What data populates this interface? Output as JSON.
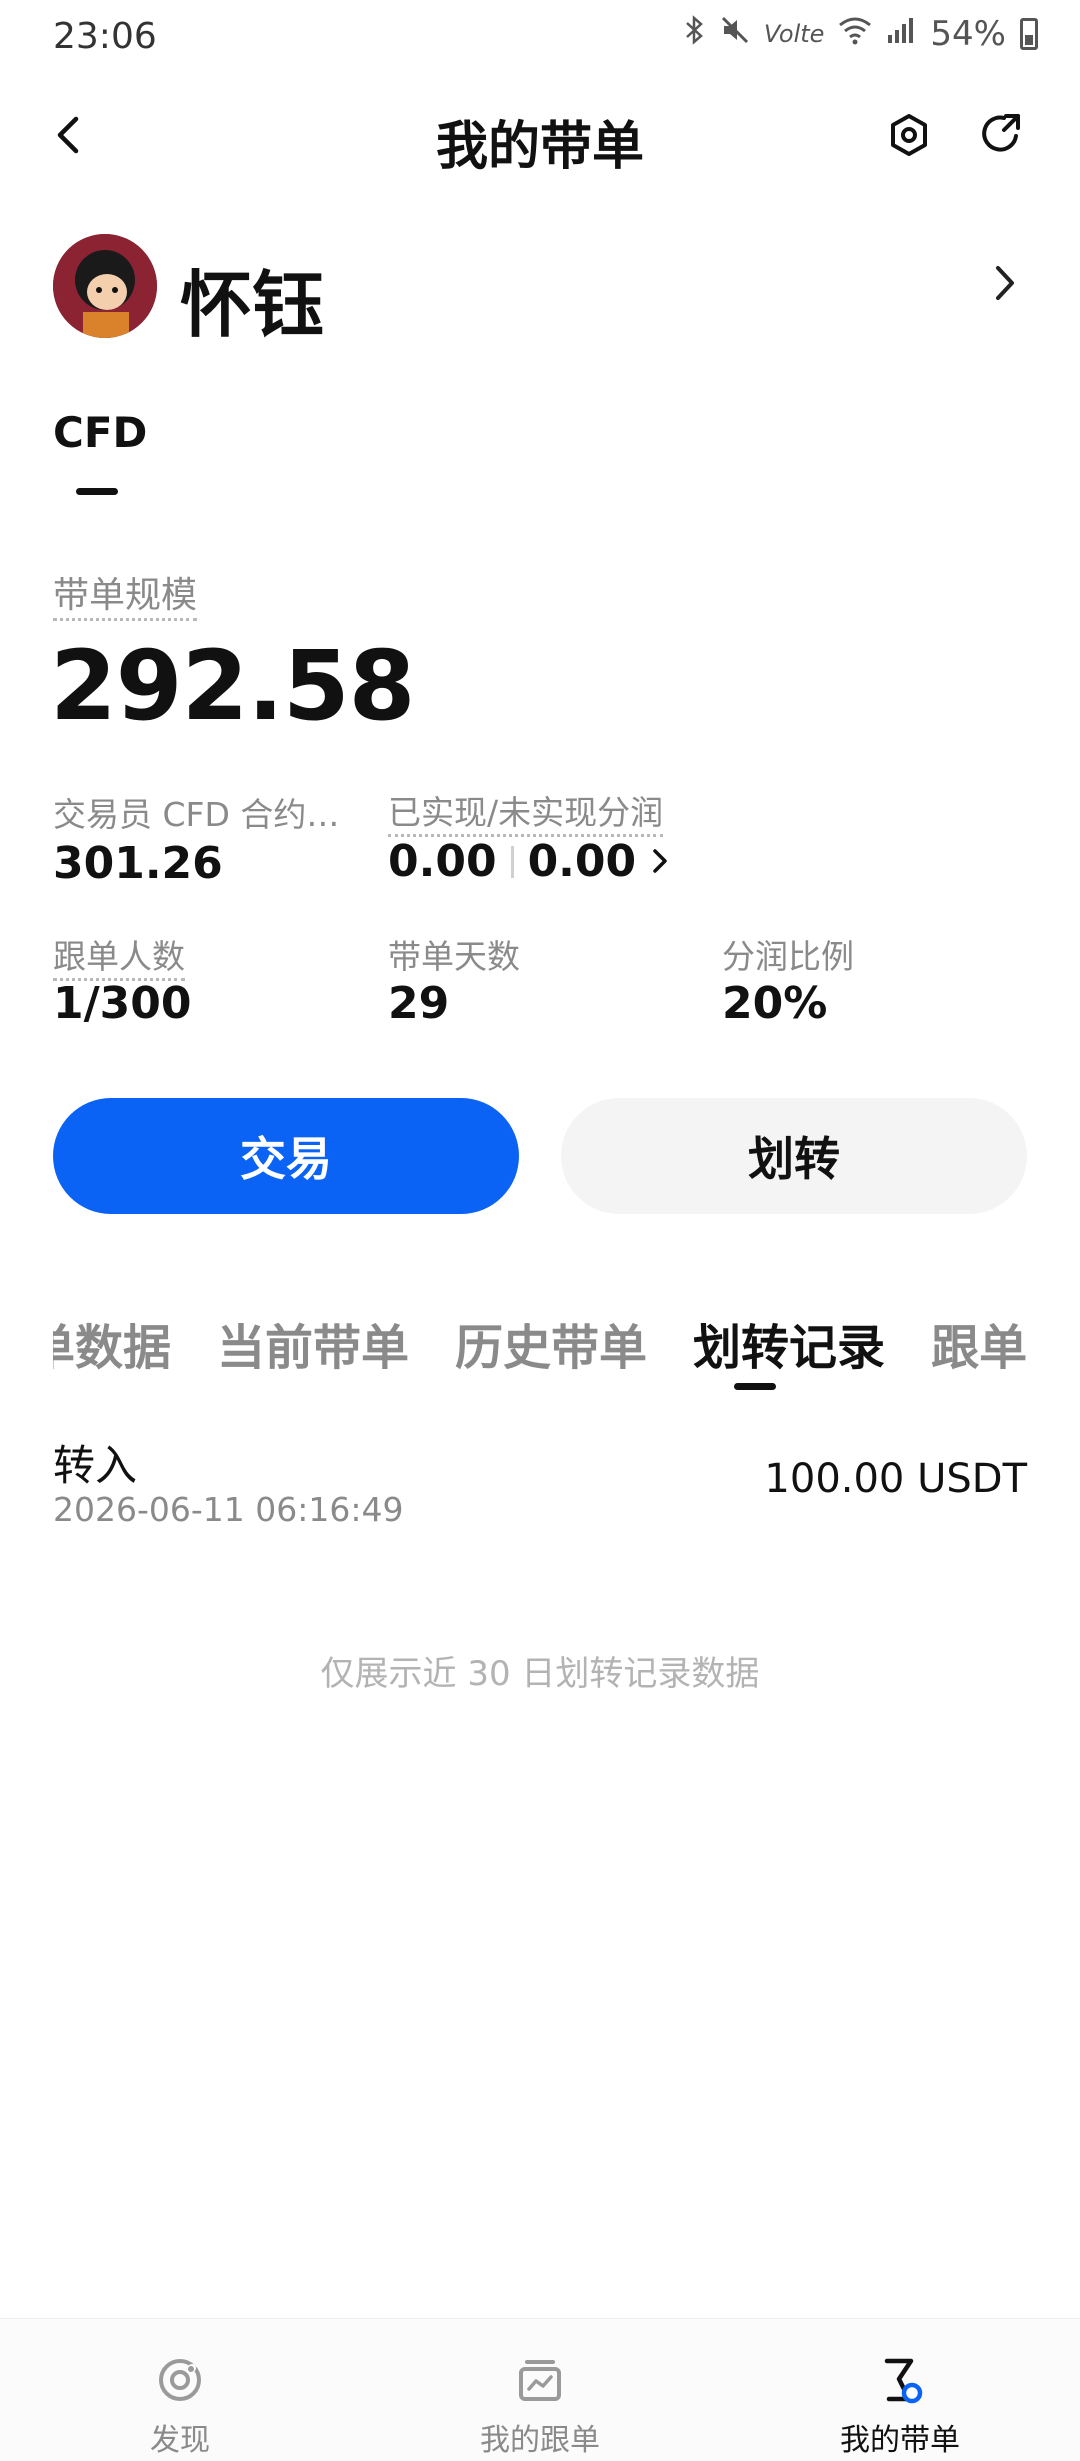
{
  "status_bar": {
    "time": "23:06",
    "battery": "54%",
    "icons": [
      "bluetooth-icon",
      "mute-icon",
      "volte-icon",
      "wifi-icon",
      "signal-icon",
      "battery-icon"
    ],
    "volte_text": "Volte"
  },
  "header": {
    "title": "我的带单"
  },
  "profile": {
    "name": "怀钰"
  },
  "product_tab": {
    "label": "CFD"
  },
  "summary": {
    "size_label": "带单规模",
    "size_value": "292.58"
  },
  "stats": {
    "trader_cfd_label": "交易员 CFD 合约…",
    "trader_cfd_value": "301.26",
    "profit_share_label": "已实现/未实现分润",
    "realized_value": "0.00",
    "unrealized_value": "0.00",
    "followers_label": "跟单人数",
    "followers_value": "1/300",
    "days_label": "带单天数",
    "days_value": "29",
    "ratio_label": "分润比例",
    "ratio_value": "20%"
  },
  "actions": {
    "trade_label": "交易",
    "transfer_label": "划转"
  },
  "subtabs": [
    {
      "label": "单数据"
    },
    {
      "label": "当前带单"
    },
    {
      "label": "历史带单"
    },
    {
      "label": "划转记录",
      "active": true
    },
    {
      "label": "跟单者"
    }
  ],
  "records": [
    {
      "type": "转入",
      "time": "2026-06-11 06:16:49",
      "amount": "100.00 USDT"
    }
  ],
  "footnote": "仅展示近 30 日划转记录数据",
  "bottom_nav": [
    {
      "label": "发现",
      "icon": "discover-icon"
    },
    {
      "label": "我的跟单",
      "icon": "copy-trade-icon"
    },
    {
      "label": "我的带单",
      "icon": "lead-trade-icon",
      "active": true
    }
  ],
  "colors": {
    "primary": "#0b63f6",
    "text": "#111111",
    "muted": "#8a8a8a",
    "secondary_button": "#f4f4f4"
  }
}
